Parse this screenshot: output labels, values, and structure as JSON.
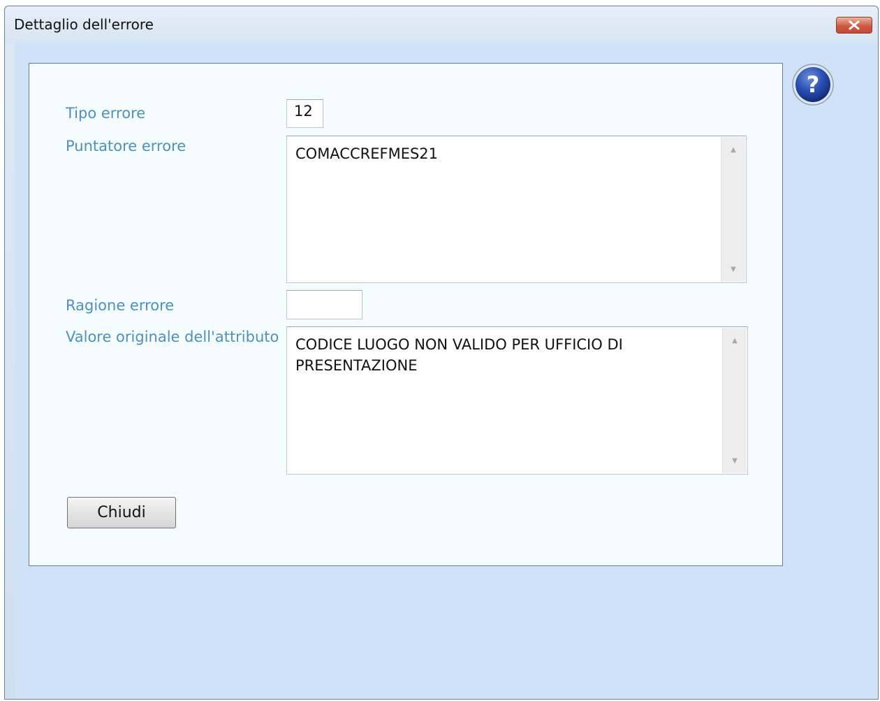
{
  "window": {
    "title": "Dettaglio dell'errore"
  },
  "form": {
    "tipo_label": "Tipo errore",
    "tipo_value": "12",
    "puntatore_label": "Puntatore errore",
    "puntatore_value": "COMACCREFMES21",
    "ragione_label": "Ragione errore",
    "ragione_value": "",
    "valore_label": "Valore originale dell'attributo",
    "valore_value": "CODICE LUOGO NON VALIDO PER UFFICIO DI\nPRESENTAZIONE"
  },
  "buttons": {
    "close_label": "Chiudi"
  },
  "icons": {
    "help": "help-question-icon",
    "window_close": "close-x-icon"
  },
  "colors": {
    "label": "#4f8fc1",
    "panel_bg": "#f4fcfd",
    "client_bg": "#cfe2f8",
    "close_button": "#c75a46"
  }
}
